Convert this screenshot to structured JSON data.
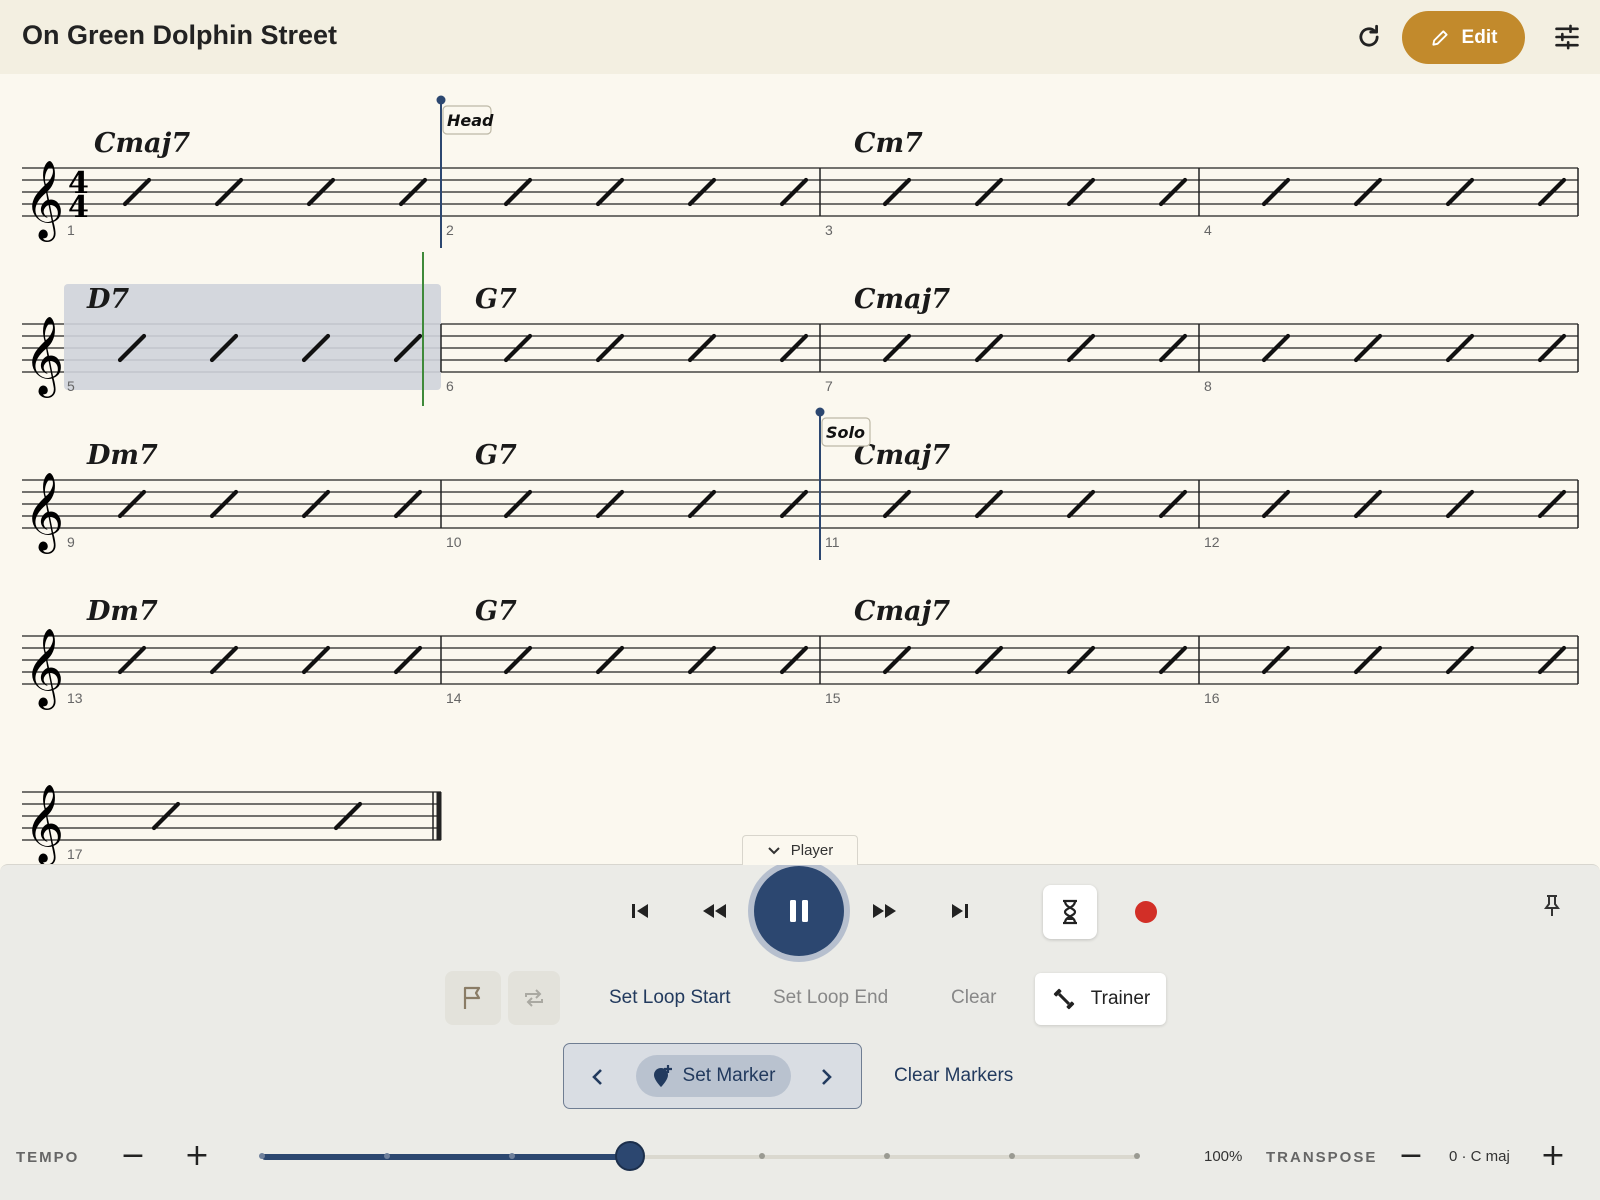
{
  "header": {
    "title": "On Green Dolphin Street",
    "edit_label": "Edit",
    "icons": [
      "refresh-icon",
      "pencil-icon",
      "sliders-icon"
    ]
  },
  "score": {
    "time_signature": "4/4",
    "measures": [
      {
        "number": "1",
        "chord": "Cmaj7",
        "slashes": 4
      },
      {
        "number": "2",
        "chord": "",
        "slashes": 4
      },
      {
        "number": "3",
        "chord": "Cm7",
        "slashes": 4
      },
      {
        "number": "4",
        "chord": "",
        "slashes": 4
      },
      {
        "number": "5",
        "chord": "D7",
        "slashes": 4
      },
      {
        "number": "6",
        "chord": "G7",
        "slashes": 4
      },
      {
        "number": "7",
        "chord": "Cmaj7",
        "slashes": 4
      },
      {
        "number": "8",
        "chord": "",
        "slashes": 4
      },
      {
        "number": "9",
        "chord": "Dm7",
        "slashes": 4
      },
      {
        "number": "10",
        "chord": "G7",
        "slashes": 4
      },
      {
        "number": "11",
        "chord": "Cmaj7",
        "slashes": 4
      },
      {
        "number": "12",
        "chord": "",
        "slashes": 4
      },
      {
        "number": "13",
        "chord": "Dm7",
        "slashes": 4
      },
      {
        "number": "14",
        "chord": "G7",
        "slashes": 4
      },
      {
        "number": "15",
        "chord": "Cmaj7",
        "slashes": 4
      },
      {
        "number": "16",
        "chord": "",
        "slashes": 4
      },
      {
        "number": "17",
        "chord": "",
        "slashes": 2
      }
    ],
    "markers": [
      {
        "label": "Head",
        "measure": 2
      },
      {
        "label": "Solo",
        "measure": 11
      }
    ],
    "highlighted_measure": 5,
    "playhead_beat_in_measure": 4,
    "colors": {
      "marker": "#2c4770",
      "playhead": "#3f8a3a",
      "highlight": "#cfd3da"
    }
  },
  "player": {
    "tab_label": "Player",
    "set_loop_start": "Set Loop Start",
    "set_loop_end": "Set Loop End",
    "clear": "Clear",
    "trainer": "Trainer",
    "set_marker": "Set Marker",
    "clear_markers": "Clear Markers",
    "tempo_label": "TEMPO",
    "tempo_value": "100%",
    "tempo_fraction": 0.42,
    "transpose_label": "TRANSPOSE",
    "transpose_value": "0 · C maj",
    "minus": "−",
    "plus": "+",
    "accent_color": "#2c4770",
    "record_color": "#d22f27"
  }
}
